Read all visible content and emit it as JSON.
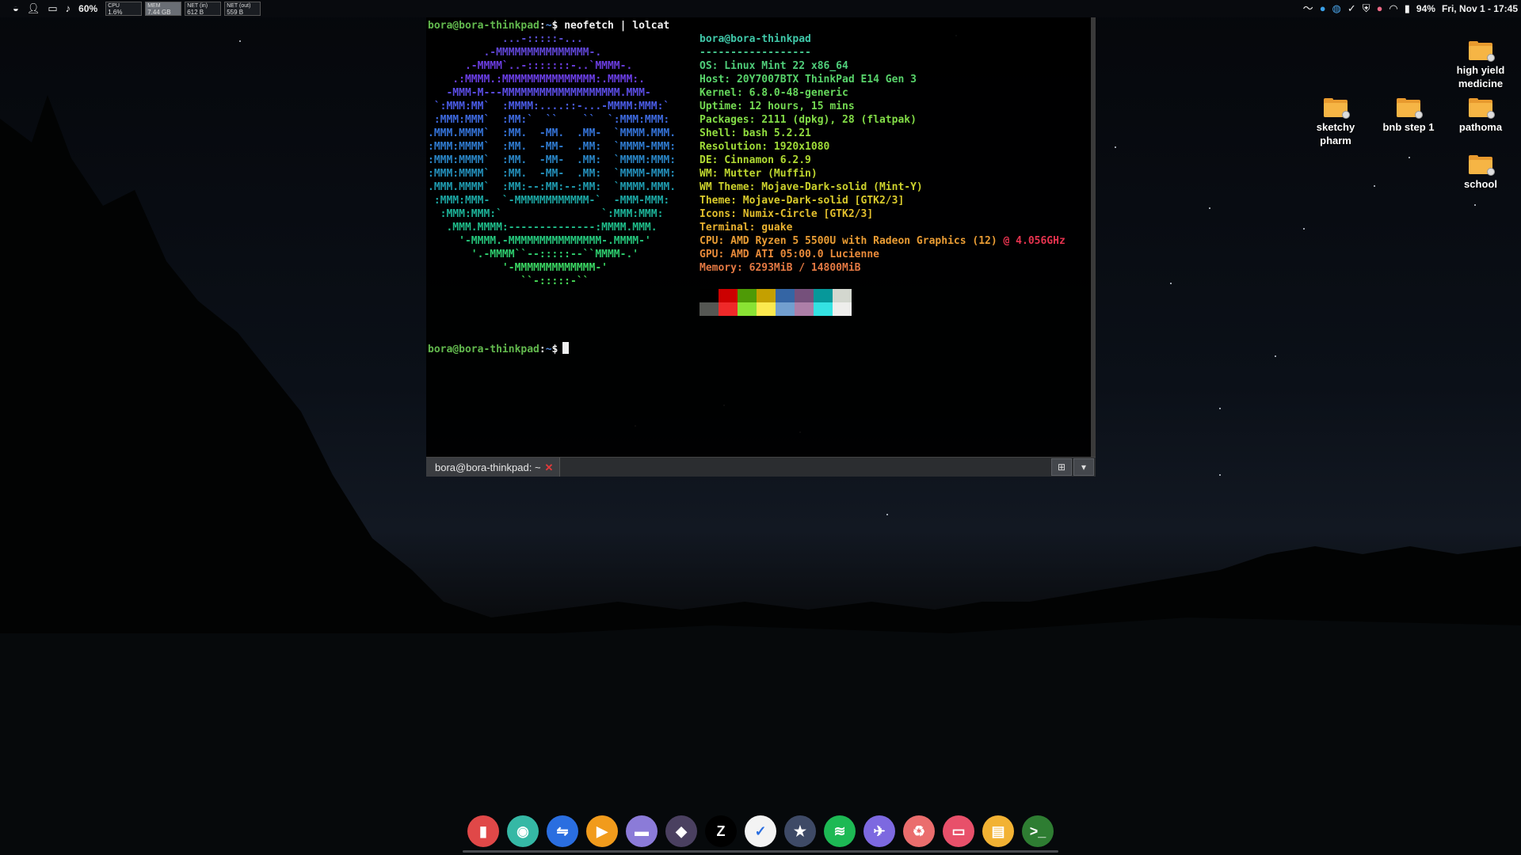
{
  "panel": {
    "icons": [
      "mint-menu-icon",
      "user-icon",
      "network-card-icon",
      "music-note-icon"
    ],
    "volume_label": "60%",
    "sysmon": [
      {
        "label": "CPU",
        "value": "1.6%"
      },
      {
        "label": "MEM",
        "value": "7.44 GB"
      },
      {
        "label": "NET (in)",
        "value": "612 B"
      },
      {
        "label": "NET (out)",
        "value": "559 B"
      }
    ],
    "battery_label": "94%",
    "clock": "Fri, Nov 1 - 17:45"
  },
  "terminal": {
    "prompt_user": "bora@bora-thinkpad",
    "prompt_sep": ":",
    "prompt_path": "~",
    "prompt_symbol": "$",
    "command": " neofetch | lolcat",
    "ascii_art": [
      "            ...-:::::-...",
      "         .-MMMMMMMMMMMMMMM-.",
      "      .-MMMM`..-:::::::-..`MMMM-.",
      "    .:MMMM.:MMMMMMMMMMMMMMM:.MMMM:.",
      "   -MMM-M---MMMMMMMMMMMMMMMMMMM.MMM-",
      " `:MMM:MM`  :MMMM:....::-...-MMMM:MMM:`",
      " :MMM:MMM`  :MM:`  ``    ``  `:MMM:MMM:",
      ".MMM.MMMM`  :MM.  -MM.  .MM-  `MMMM.MMM.",
      ":MMM:MMMM`  :MM.  -MM-  .MM:  `MMMM-MMM:",
      ":MMM:MMMM`  :MM.  -MM-  .MM:  `MMMM:MMM:",
      ":MMM:MMMM`  :MM.  -MM-  .MM:  `MMMM-MMM:",
      ".MMM.MMMM`  :MM:--:MM:--:MM:  `MMMM.MMM.",
      " :MMM:MMM-  `-MMMMMMMMMMMM-`  -MMM-MMM:",
      "  :MMM:MMM:`                `:MMM:MMM:",
      "   .MMM.MMMM:--------------:MMMM.MMM.",
      "     '-MMMM.-MMMMMMMMMMMMMMM-.MMMM-'",
      "       '.-MMMM``--:::::--``MMMM-.'",
      "            '-MMMMMMMMMMMMM-'",
      "               ``-:::::-``"
    ],
    "info": [
      "bora@bora-thinkpad",
      "------------------",
      "OS: Linux Mint 22 x86_64",
      "Host: 20Y7007BTX ThinkPad E14 Gen 3",
      "Kernel: 6.8.0-48-generic",
      "Uptime: 12 hours, 15 mins",
      "Packages: 2111 (dpkg), 28 (flatpak)",
      "Shell: bash 5.2.21",
      "Resolution: 1920x1080",
      "DE: Cinnamon 6.2.9",
      "WM: Mutter (Muffin)",
      "WM Theme: Mojave-Dark-solid (Mint-Y)",
      "Theme: Mojave-Dark-solid [GTK2/3]",
      "Icons: Numix-Circle [GTK2/3]",
      "Terminal: guake",
      "CPU: AMD Ryzen 5 5500U with Radeon Graphics (12) @ 4.056GHz",
      "GPU: AMD ATI 05:00.0 Lucienne",
      "Memory: 6293MiB / 14800MiB"
    ],
    "ascii_colors": [
      "#5a4fd6",
      "#6046d8",
      "#6b3de0",
      "#6a3ee6",
      "#5b4de6",
      "#4a5be6",
      "#3d69df",
      "#3473d8",
      "#2f7bd0",
      "#2985c6",
      "#2490bc",
      "#1f9bb0",
      "#1ca7a4",
      "#1cb298",
      "#1fbd8a",
      "#25c67c",
      "#2ece6f",
      "#3ad563",
      "#46da58"
    ],
    "info_colors": [
      "#3fc7a8",
      "#45c98f",
      "#4fce7a",
      "#58d46b",
      "#66d85c",
      "#74da52",
      "#82dc47",
      "#91dd3f",
      "#a0dc38",
      "#b0da32",
      "#bfd72f",
      "#cdd22d",
      "#d9ca2c",
      "#e3bf2d",
      "#e8b130",
      "#e99c34",
      "#e98a3a",
      "#e37843"
    ],
    "cpu_freq_color": "#e6334f",
    "swatches_top": [
      "#000000",
      "#cc0000",
      "#4e9a06",
      "#c4a000",
      "#3465a4",
      "#75507b",
      "#06989a",
      "#d3d7cf"
    ],
    "swatches_bottom": [
      "#555753",
      "#ef2929",
      "#8ae234",
      "#fce94f",
      "#729fcf",
      "#ad7fa8",
      "#34e2e2",
      "#eeeeec"
    ],
    "tab_title": "bora@bora-thinkpad: ~",
    "tab_close": "✕"
  },
  "desktop_icons": [
    {
      "label": "high yield medicine"
    },
    {
      "label": "sketchy pharm"
    },
    {
      "label": "bnb step 1"
    },
    {
      "label": "pathoma"
    },
    {
      "label": "school"
    }
  ],
  "dock": [
    {
      "name": "red-book-app-icon",
      "glyph": "▮",
      "color": "#e04848"
    },
    {
      "name": "system-settings-icon",
      "glyph": "◉",
      "color": "#35b8a5"
    },
    {
      "name": "audio-app-icon",
      "glyph": "⇋",
      "color": "#2a6ee0"
    },
    {
      "name": "media-player-icon",
      "glyph": "▶",
      "color": "#f19b1c"
    },
    {
      "name": "files-icon",
      "glyph": "▬",
      "color": "#8b7bd8"
    },
    {
      "name": "obsidian-icon",
      "glyph": "◆",
      "color": "#4a4060"
    },
    {
      "name": "zed-editor-icon",
      "glyph": "Z",
      "color": "#000000"
    },
    {
      "name": "tasks-app-icon",
      "glyph": "✓",
      "color": "#f3f3f3"
    },
    {
      "name": "favorites-app-icon",
      "glyph": "★",
      "color": "#3e4a66"
    },
    {
      "name": "spotify-icon",
      "glyph": "≋",
      "color": "#1db954"
    },
    {
      "name": "paper-plane-icon",
      "glyph": "✈",
      "color": "#7d69e0"
    },
    {
      "name": "trash-recycle-icon",
      "glyph": "♻",
      "color": "#ea6d6d"
    },
    {
      "name": "slides-app-icon",
      "glyph": "▭",
      "color": "#e8506a"
    },
    {
      "name": "notes-app-icon",
      "glyph": "▤",
      "color": "#f2b233"
    },
    {
      "name": "terminal-icon",
      "glyph": ">_",
      "color": "#2e7d32"
    }
  ]
}
